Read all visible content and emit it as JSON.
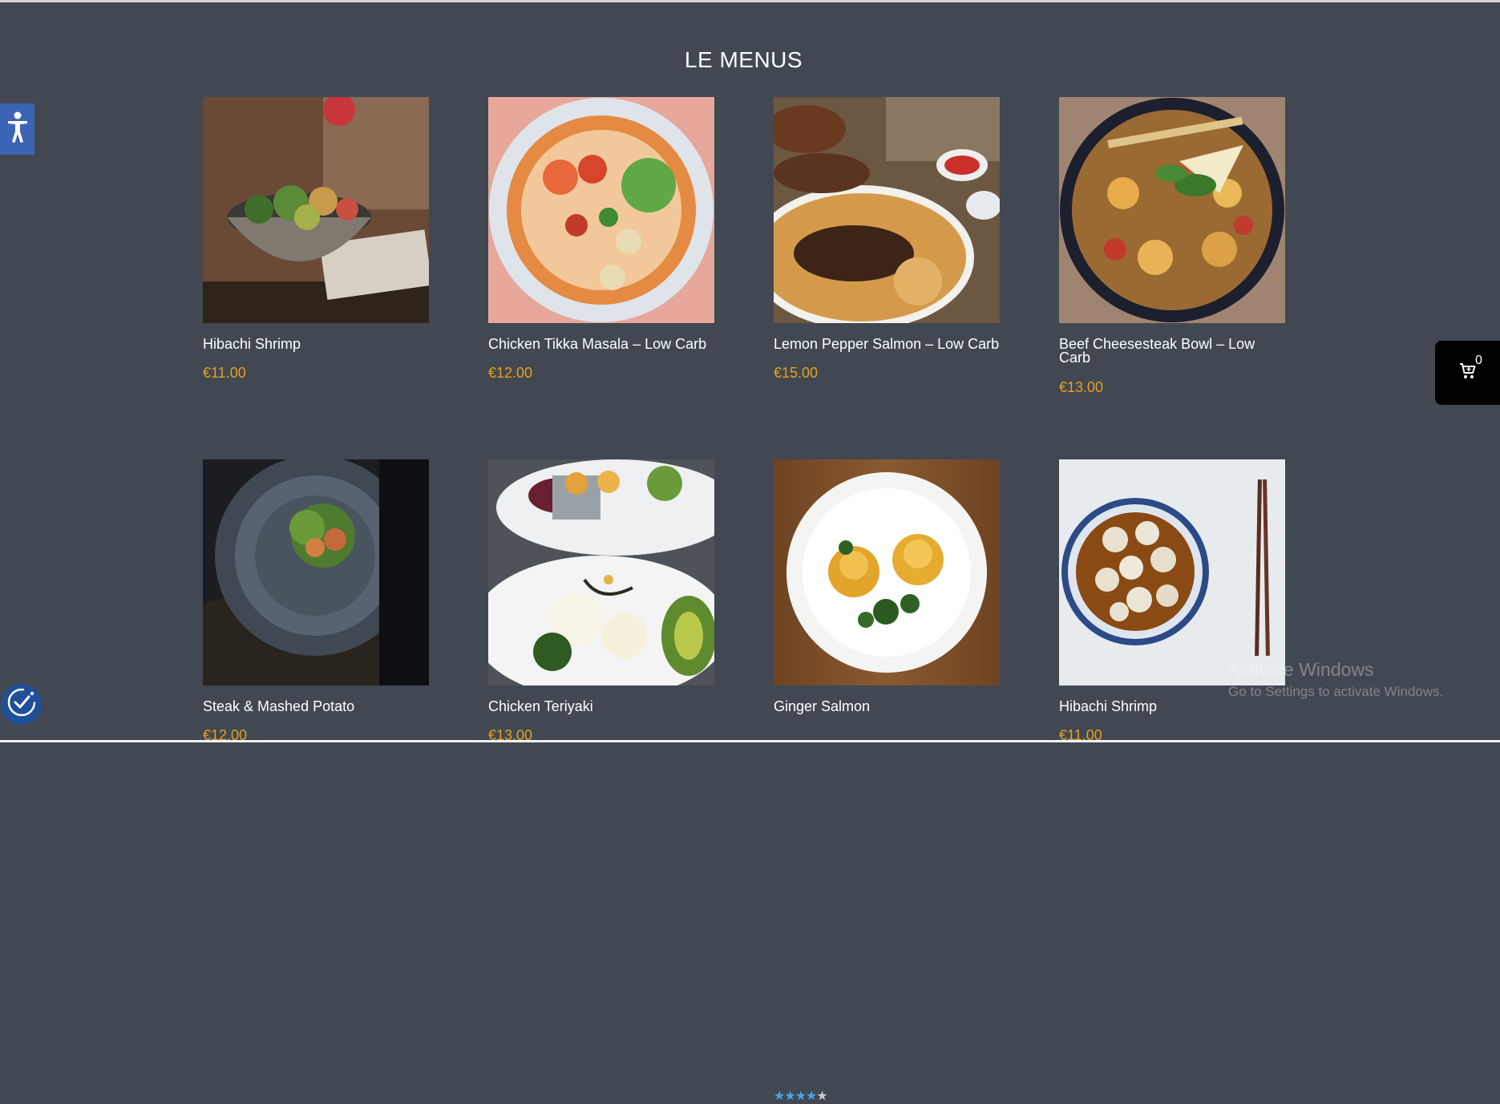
{
  "page": {
    "title": "LE MENUS"
  },
  "products": [
    {
      "name": "Hibachi Shrimp",
      "price": "€11.00"
    },
    {
      "name": "Chicken Tikka Masala – Low Carb",
      "price": "€12.00"
    },
    {
      "name": "Lemon Pepper Salmon – Low Carb",
      "price": "€15.00"
    },
    {
      "name": "Beef Cheesesteak Bowl – Low Carb",
      "price": "€13.00"
    },
    {
      "name": "Steak & Mashed Potato",
      "price": "€12.00"
    },
    {
      "name": "Chicken Teriyaki",
      "price": "€13.00"
    },
    {
      "name": "Ginger Salmon",
      "rating": 4,
      "rating_max": 5
    },
    {
      "name": "Hibachi Shrimp",
      "price": "€11.00"
    }
  ],
  "cart": {
    "count": "0",
    "icon": "cart-icon"
  },
  "accessibility": {
    "icon": "accessibility-person-icon",
    "badge_icon": "accessibility-check-icon"
  },
  "watermark": {
    "line1": "Activate Windows",
    "line2": "Go to Settings to activate Windows."
  },
  "colors": {
    "background": "#414852",
    "price": "#e6a11e",
    "accessibility": "#3c64b4",
    "cart": "#000000"
  }
}
